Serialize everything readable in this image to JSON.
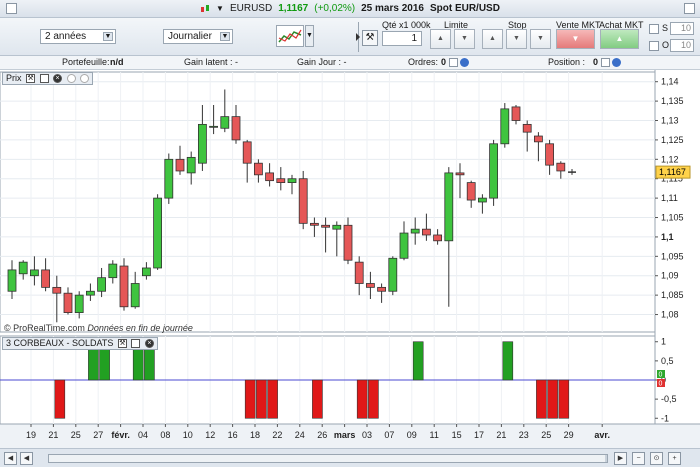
{
  "titlebar": {
    "instrument": "EURUSD",
    "price": "1,1167",
    "change": "(+0,02%)",
    "date": "25 mars 2016",
    "spot": "Spot EUR/USD"
  },
  "toolbar": {
    "period": "2 années",
    "interval": "Journalier",
    "qty_label": "Qté x1 000k",
    "qty_value": "1",
    "limit_label": "Limite",
    "stop_label": "Stop",
    "sell_label": "Vente MKT",
    "buy_label": "Achat MKT",
    "s_label": "S",
    "o_label": "O",
    "s_value": "10",
    "o_value": "10"
  },
  "statusbar": {
    "portfolio": "Portefeuille:",
    "portfolio_val": "n/d",
    "latent": "Gain latent : -",
    "day": "Gain Jour : -",
    "orders": "Ordres:",
    "orders_val": "0",
    "position": "Position :",
    "position_val": "0"
  },
  "panels": {
    "price": "Prix",
    "indicator": "3 CORBEAUX - SOLDATS",
    "copyright": "© ProRealTime.com",
    "copyright_note": "Données en fin de journée"
  },
  "icons": {
    "titlebar": "candlestick-icon",
    "wrench": "wrench-icon",
    "window": "window-icon",
    "close": "close-icon",
    "chart_type": "chart-type-icon"
  },
  "colors": {
    "bull": "#3fc43f",
    "bear": "#e55757",
    "baseline": "#4a4ad0",
    "price_tag": "#ffd24a"
  },
  "chart_data": [
    {
      "type": "candlestick",
      "title": "",
      "x_ticks": [
        "19",
        "21",
        "25",
        "27",
        "févr.",
        "04",
        "08",
        "10",
        "12",
        "16",
        "18",
        "22",
        "24",
        "26",
        "mars",
        "03",
        "07",
        "09",
        "11",
        "15",
        "17",
        "21",
        "23",
        "25",
        "29",
        "avr."
      ],
      "y_ticks": [
        "1,14",
        "1,135",
        "1,13",
        "1,125",
        "1,12",
        "1,115",
        "1,11",
        "1,105",
        "1,1",
        "1,095",
        "1,09",
        "1,085",
        "1,08"
      ],
      "ylim": [
        1.0755,
        1.1425
      ],
      "last_price": "1,1167",
      "candles": [
        {
          "o": 1.086,
          "h": 1.094,
          "l": 1.084,
          "c": 1.0915
        },
        {
          "o": 1.0905,
          "h": 1.094,
          "l": 1.089,
          "c": 1.0935
        },
        {
          "o": 1.09,
          "h": 1.095,
          "l": 1.0875,
          "c": 1.0915
        },
        {
          "o": 1.0915,
          "h": 1.0945,
          "l": 1.086,
          "c": 1.087
        },
        {
          "o": 1.087,
          "h": 1.09,
          "l": 1.078,
          "c": 1.0855
        },
        {
          "o": 1.0855,
          "h": 1.087,
          "l": 1.08,
          "c": 1.0805
        },
        {
          "o": 1.0805,
          "h": 1.086,
          "l": 1.079,
          "c": 1.085
        },
        {
          "o": 1.085,
          "h": 1.088,
          "l": 1.0835,
          "c": 1.086
        },
        {
          "o": 1.086,
          "h": 1.092,
          "l": 1.0845,
          "c": 1.0895
        },
        {
          "o": 1.0895,
          "h": 1.094,
          "l": 1.088,
          "c": 1.093
        },
        {
          "o": 1.0925,
          "h": 1.0945,
          "l": 1.081,
          "c": 1.082
        },
        {
          "o": 1.082,
          "h": 1.091,
          "l": 1.0815,
          "c": 1.088
        },
        {
          "o": 1.09,
          "h": 1.0935,
          "l": 1.089,
          "c": 1.092
        },
        {
          "o": 1.092,
          "h": 1.111,
          "l": 1.0915,
          "c": 1.11
        },
        {
          "o": 1.11,
          "h": 1.1215,
          "l": 1.1085,
          "c": 1.12
        },
        {
          "o": 1.12,
          "h": 1.1235,
          "l": 1.116,
          "c": 1.117
        },
        {
          "o": 1.1165,
          "h": 1.122,
          "l": 1.1135,
          "c": 1.1205
        },
        {
          "o": 1.119,
          "h": 1.134,
          "l": 1.117,
          "c": 1.129
        },
        {
          "o": 1.1285,
          "h": 1.134,
          "l": 1.1265,
          "c": 1.1285
        },
        {
          "o": 1.128,
          "h": 1.138,
          "l": 1.127,
          "c": 1.131
        },
        {
          "o": 1.131,
          "h": 1.134,
          "l": 1.124,
          "c": 1.125
        },
        {
          "o": 1.1245,
          "h": 1.125,
          "l": 1.114,
          "c": 1.119
        },
        {
          "o": 1.119,
          "h": 1.12,
          "l": 1.114,
          "c": 1.116
        },
        {
          "o": 1.1165,
          "h": 1.119,
          "l": 1.113,
          "c": 1.1145
        },
        {
          "o": 1.115,
          "h": 1.118,
          "l": 1.112,
          "c": 1.114
        },
        {
          "o": 1.114,
          "h": 1.116,
          "l": 1.111,
          "c": 1.115
        },
        {
          "o": 1.115,
          "h": 1.117,
          "l": 1.102,
          "c": 1.1035
        },
        {
          "o": 1.1035,
          "h": 1.105,
          "l": 1.1,
          "c": 1.103
        },
        {
          "o": 1.103,
          "h": 1.105,
          "l": 1.096,
          "c": 1.1025
        },
        {
          "o": 1.102,
          "h": 1.104,
          "l": 1.095,
          "c": 1.103
        },
        {
          "o": 1.103,
          "h": 1.105,
          "l": 1.093,
          "c": 1.094
        },
        {
          "o": 1.0935,
          "h": 1.095,
          "l": 1.085,
          "c": 1.088
        },
        {
          "o": 1.088,
          "h": 1.091,
          "l": 1.084,
          "c": 1.087
        },
        {
          "o": 1.087,
          "h": 1.088,
          "l": 1.083,
          "c": 1.086
        },
        {
          "o": 1.086,
          "h": 1.095,
          "l": 1.085,
          "c": 1.0945
        },
        {
          "o": 1.0945,
          "h": 1.104,
          "l": 1.094,
          "c": 1.101
        },
        {
          "o": 1.101,
          "h": 1.105,
          "l": 1.098,
          "c": 1.102
        },
        {
          "o": 1.102,
          "h": 1.106,
          "l": 1.099,
          "c": 1.1005
        },
        {
          "o": 1.1005,
          "h": 1.102,
          "l": 1.098,
          "c": 1.099
        },
        {
          "o": 1.099,
          "h": 1.118,
          "l": 1.082,
          "c": 1.1165
        },
        {
          "o": 1.1165,
          "h": 1.119,
          "l": 1.11,
          "c": 1.116
        },
        {
          "o": 1.114,
          "h": 1.1145,
          "l": 1.1075,
          "c": 1.1095
        },
        {
          "o": 1.109,
          "h": 1.111,
          "l": 1.106,
          "c": 1.11
        },
        {
          "o": 1.11,
          "h": 1.125,
          "l": 1.108,
          "c": 1.124
        },
        {
          "o": 1.124,
          "h": 1.1345,
          "l": 1.123,
          "c": 1.133
        },
        {
          "o": 1.1335,
          "h": 1.134,
          "l": 1.129,
          "c": 1.13
        },
        {
          "o": 1.129,
          "h": 1.13,
          "l": 1.122,
          "c": 1.127
        },
        {
          "o": 1.126,
          "h": 1.127,
          "l": 1.1195,
          "c": 1.1245
        },
        {
          "o": 1.124,
          "h": 1.125,
          "l": 1.116,
          "c": 1.1185
        },
        {
          "o": 1.119,
          "h": 1.1195,
          "l": 1.115,
          "c": 1.117
        },
        {
          "o": 1.1167,
          "h": 1.1175,
          "l": 1.116,
          "c": 1.1167
        }
      ]
    },
    {
      "type": "bar",
      "title": "",
      "y_ticks": [
        "1",
        "0,5",
        "0",
        "-0,5",
        "-1"
      ],
      "ylim": [
        -1.15,
        1.15
      ],
      "zero_tags": [
        "0",
        "0"
      ],
      "values": [
        0,
        0,
        0,
        0,
        -1,
        0,
        0,
        1,
        1,
        0,
        0,
        1,
        1,
        0,
        0,
        0,
        0,
        0,
        0,
        0,
        0,
        -1,
        -1,
        -1,
        0,
        0,
        0,
        -1,
        0,
        0,
        0,
        -1,
        -1,
        0,
        0,
        0,
        1,
        0,
        0,
        0,
        0,
        0,
        0,
        0,
        1,
        0,
        0,
        -1,
        -1,
        -1,
        0
      ]
    }
  ]
}
